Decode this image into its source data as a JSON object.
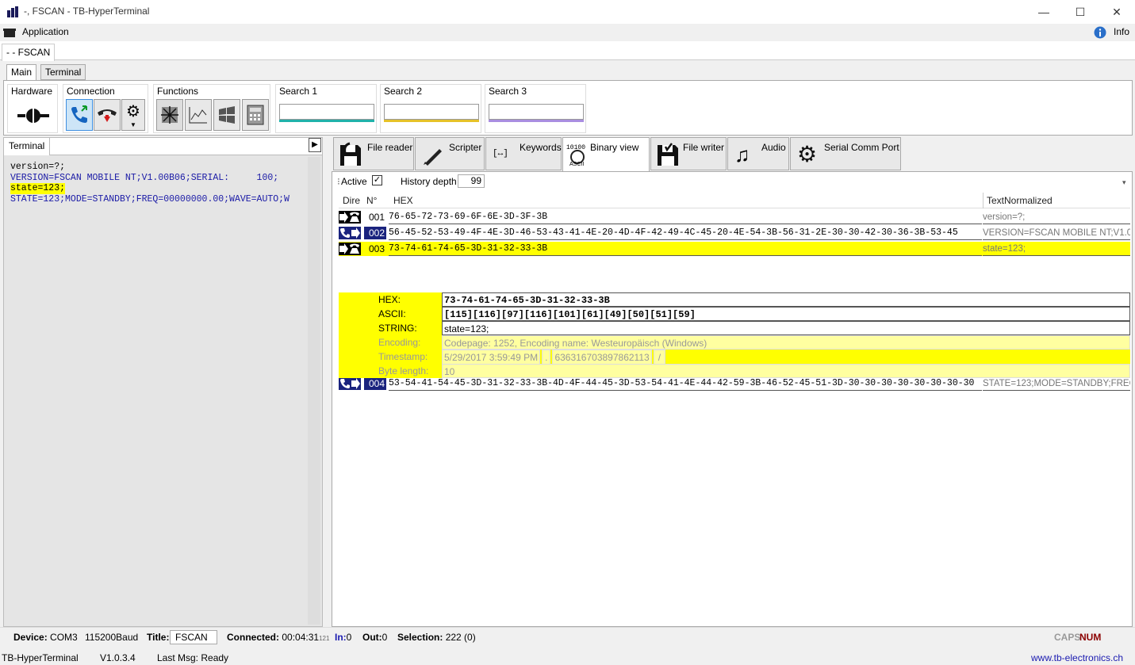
{
  "window": {
    "title": "-, FSCAN - TB-HyperTerminal",
    "minimize": "—",
    "maximize": "☐",
    "close": "✕"
  },
  "menu": {
    "application": "Application",
    "info": "Info"
  },
  "doc_tab": "- - FSCAN",
  "ribbon_tabs": [
    "Main",
    "Terminal"
  ],
  "ribbon": {
    "hardware": "Hardware",
    "connection": "Connection",
    "functions": "Functions",
    "search1": "Search 1",
    "search2": "Search 2",
    "search3": "Search 3",
    "search_colors": [
      "#20b2aa",
      "#e6c229",
      "#a98ee0"
    ]
  },
  "terminal": {
    "tab": "Terminal",
    "lines": [
      {
        "text": "version=?;",
        "color": "#000000",
        "highlight": false
      },
      {
        "text": "VERSION=FSCAN MOBILE NT;V1.00B06;SERIAL:     100;",
        "color": "#1a1aa6",
        "highlight": false
      },
      {
        "text": "state=123;",
        "color": "#000000",
        "highlight": true
      },
      {
        "text": "STATE=123;MODE=STANDBY;FREQ=00000000.00;WAVE=AUTO;W",
        "color": "#1a1aa6",
        "highlight": false
      }
    ]
  },
  "tools_tabs": [
    {
      "label": "File reader",
      "icon": "floppy-icon"
    },
    {
      "label": "Scripter",
      "icon": "pen-icon"
    },
    {
      "label": "Keywords",
      "icon": "keywords-icon"
    },
    {
      "label": "Binary view",
      "icon": "binary-icon"
    },
    {
      "label": "File writer",
      "icon": "floppy-write-icon"
    },
    {
      "label": "Audio",
      "icon": "music-note-icon"
    },
    {
      "label": "Serial Comm Port",
      "icon": "gear-icon"
    }
  ],
  "binary_view": {
    "active_label": "Active",
    "active_checked": true,
    "history_label": "History depth",
    "history_value": "99",
    "columns": {
      "dir": "Dire",
      "num": "N°",
      "hex": "HEX",
      "text": "TextNormalized"
    },
    "rows": [
      {
        "num": "001",
        "dir": "out",
        "hex": "76-65-72-73-69-6F-6E-3D-3F-3B",
        "text": "version=?;"
      },
      {
        "num": "002",
        "dir": "in",
        "hex": "56-45-52-53-49-4F-4E-3D-46-53-43-41-4E-20-4D-4F-42-49-4C-45-20-4E-54-3B-56-31-2E-30-30-42-30-36-3B-53-45",
        "text": "VERSION=FSCAN MOBILE NT;V1.00"
      },
      {
        "num": "003",
        "dir": "out",
        "hex": "73-74-61-74-65-3D-31-32-33-3B",
        "text": "state=123;"
      },
      {
        "num": "004",
        "dir": "in",
        "hex": "53-54-41-54-45-3D-31-32-33-3B-4D-4F-44-45-3D-53-54-41-4E-44-42-59-3B-46-52-45-51-3D-30-30-30-30-30-30-30-30",
        "text": "STATE=123;MODE=STANDBY;FREQ="
      }
    ],
    "detail": {
      "hex_label": "HEX:",
      "hex": "73-74-61-74-65-3D-31-32-33-3B",
      "ascii_label": "ASCII:",
      "ascii": "[115][116][97][116][101][61][49][50][51][59]",
      "string_label": "STRING:",
      "string": "state=123;",
      "encoding_label": "Encoding:",
      "encoding": "Codepage: 1252, Encoding name: Westeuropäisch (Windows)",
      "timestamp_label": "Timestamp:",
      "timestamp": "5/29/2017 3:59:49 PM",
      "timestamp_sep": ".",
      "timestamp_ticks": "636316703897862113",
      "timestamp_end": "/",
      "bytelen_label": "Byte length:",
      "bytelen": "10"
    }
  },
  "status": {
    "device_label": "Device:",
    "device": "COM3",
    "baud": "115200Baud",
    "title_label": "Title:",
    "title": "FSCAN",
    "connected_label": "Connected:",
    "connected": "00:04:31",
    "connected_ms": "121",
    "in_label": "In:",
    "in": "0",
    "out_label": "Out:",
    "out": "0",
    "selection_label": "Selection:",
    "selection": "222 (0)",
    "caps": "CAPS",
    "num": "NUM"
  },
  "footer": {
    "app": "TB-HyperTerminal",
    "version": "V1.0.3.4",
    "last_msg": "Last Msg: Ready",
    "url": "www.tb-electronics.ch"
  }
}
